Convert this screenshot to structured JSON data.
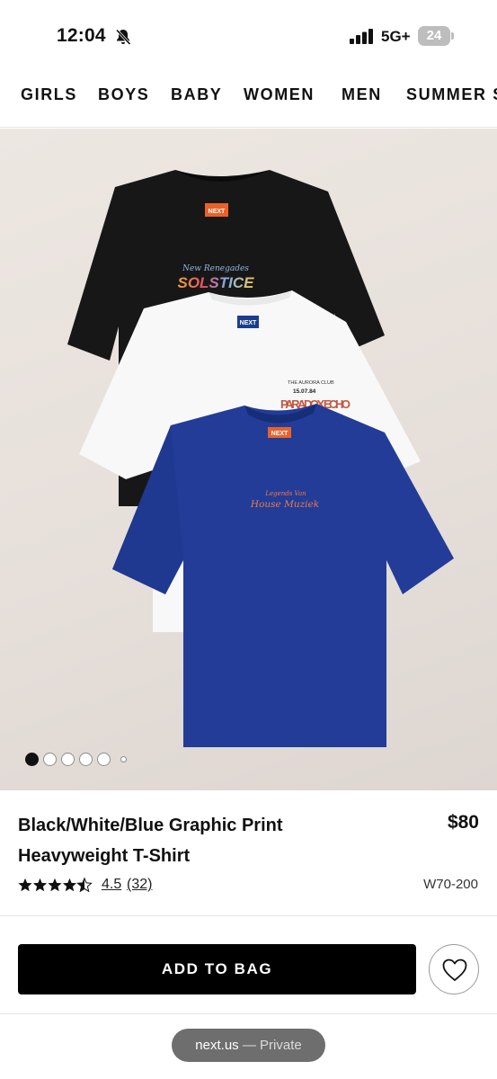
{
  "status_bar": {
    "time": "12:04",
    "network": "5G+",
    "battery": "24"
  },
  "nav": {
    "items": [
      "GIRLS",
      "BOYS",
      "BABY",
      "WOMEN",
      "MEN",
      "SUMMER S"
    ]
  },
  "gallery": {
    "image_count": 6,
    "active_index": 0,
    "print_text": {
      "black_tag": "NEXT",
      "black_line1": "New Renegades",
      "black_line2": "SOLSTICE",
      "white_tag": "NEXT",
      "white_line1": "THE AURORA CLUB",
      "white_line2": "15.07.84",
      "white_line3": "PARADOX ECHO",
      "blue_tag": "NEXT",
      "blue_line1": "Legends Van",
      "blue_line2": "House Muziek"
    }
  },
  "product": {
    "title": "Black/White/Blue Graphic Print Heavyweight T-Shirt",
    "price": "$80",
    "rating": "4.5",
    "rating_stars_value": 4.5,
    "reviews": "(32)",
    "code": "W70-200"
  },
  "actions": {
    "add_to_bag": "ADD TO BAG"
  },
  "browser": {
    "url": "next.us",
    "separator": " — ",
    "mode": "Private"
  },
  "colors": {
    "shirt_black": "#1a1a1a",
    "shirt_white": "#f7f7f7",
    "shirt_blue": "#1f3a93",
    "print_orange": "#e8622a",
    "button_bg": "#000000"
  }
}
